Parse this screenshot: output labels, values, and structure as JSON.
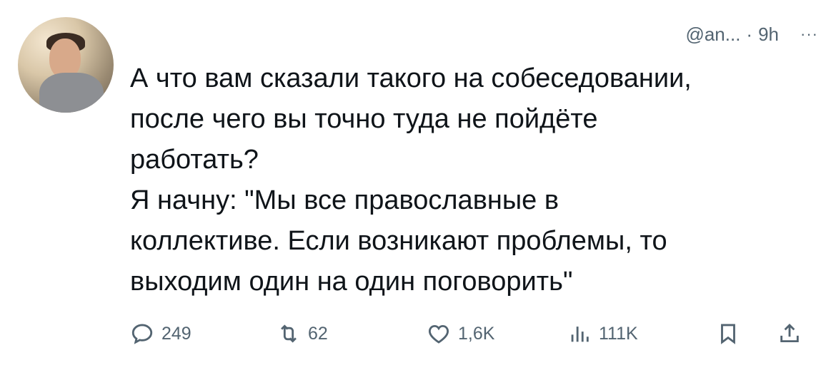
{
  "tweet": {
    "handle": "@an...",
    "separator": "·",
    "time": "9h",
    "more": "···",
    "lines": [
      "А что вам сказали такого на собеседовании,",
      "после чего вы точно туда не пойдёте",
      "работать?",
      "Я начну: \"Мы все православные в",
      "коллективе. Если возникают проблемы, то",
      "выходим один на один поговорить\""
    ]
  },
  "actions": {
    "replies": "249",
    "retweets": "62",
    "likes": "1,6K",
    "views": "111K"
  },
  "icons": {
    "reply": "reply-icon",
    "retweet": "retweet-icon",
    "like": "heart-icon",
    "views": "views-icon",
    "bookmark": "bookmark-icon",
    "share": "share-icon"
  },
  "colors": {
    "text": "#0f1419",
    "secondary": "#536471",
    "background": "#ffffff"
  }
}
